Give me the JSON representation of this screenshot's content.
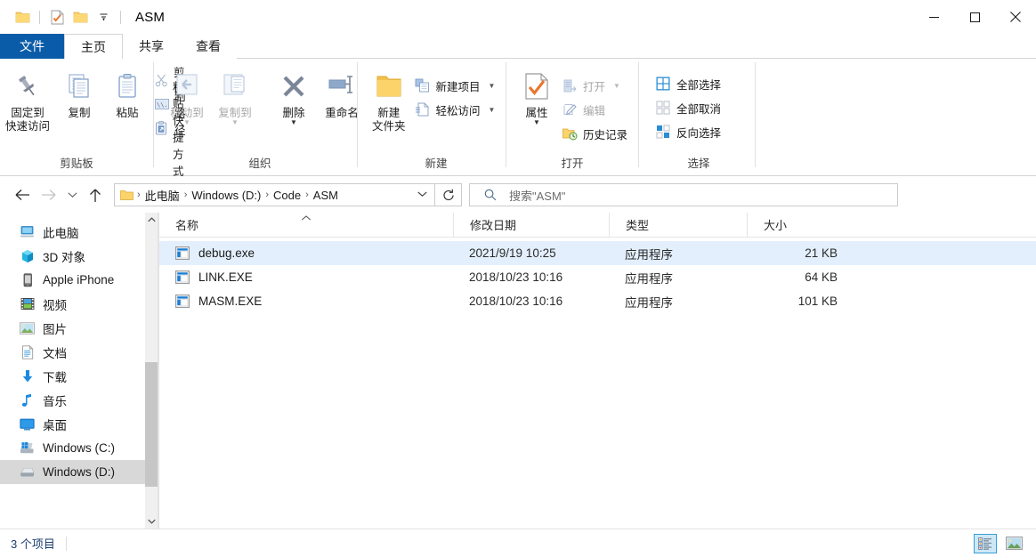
{
  "window": {
    "title": "ASM",
    "quick_access": [
      "folder-icon",
      "properties-icon",
      "new-folder-icon",
      "customize-dropdown"
    ],
    "controls": {
      "minimize": "—",
      "maximize": "□",
      "close": "✕"
    }
  },
  "tabs": [
    {
      "label": "文件",
      "key": "file"
    },
    {
      "label": "主页",
      "key": "home",
      "active": true
    },
    {
      "label": "共享",
      "key": "share"
    },
    {
      "label": "查看",
      "key": "view"
    }
  ],
  "ribbon": {
    "collapse_icon": "chevron-up-icon",
    "help_label": "?",
    "groups": [
      {
        "label": "剪贴板",
        "big": [
          {
            "label": "固定到\n快速访问",
            "line1": "固定到",
            "line2": "快速访问",
            "icon": "pin-icon"
          },
          {
            "label": "复制",
            "line1": "复制",
            "line2": "",
            "icon": "copy-icon"
          },
          {
            "label": "粘贴",
            "line1": "粘贴",
            "line2": "",
            "icon": "paste-icon"
          }
        ],
        "small": [
          {
            "label": "剪切",
            "icon": "scissors-icon",
            "dim": true
          },
          {
            "label": "复制路径",
            "icon": "copy-path-icon",
            "dim": false
          },
          {
            "label": "粘贴快捷方式",
            "icon": "paste-shortcut-icon",
            "dim": false
          }
        ]
      },
      {
        "label": "组织",
        "big": [
          {
            "line1": "移动到",
            "line2": "",
            "icon": "move-to-icon",
            "dim": true,
            "caret": true
          },
          {
            "line1": "复制到",
            "line2": "",
            "icon": "copy-to-icon",
            "dim": true,
            "caret": true
          },
          {
            "line1": "删除",
            "line2": "",
            "icon": "delete-x-icon",
            "caret": true
          },
          {
            "line1": "重命名",
            "line2": "",
            "icon": "rename-icon"
          }
        ],
        "small": []
      },
      {
        "label": "新建",
        "big": [
          {
            "line1": "新建",
            "line2": "文件夹",
            "icon": "new-folder-icon"
          }
        ],
        "small": [
          {
            "label": "新建项目",
            "icon": "new-item-icon",
            "caret": true
          },
          {
            "label": "轻松访问",
            "icon": "easy-access-icon",
            "caret": true
          }
        ]
      },
      {
        "label": "打开",
        "big": [
          {
            "line1": "属性",
            "line2": "",
            "icon": "properties-icon",
            "caret": true
          }
        ],
        "small": [
          {
            "label": "打开",
            "icon": "open-icon",
            "dim": true,
            "caret": true
          },
          {
            "label": "编辑",
            "icon": "edit-icon",
            "dim": true
          },
          {
            "label": "历史记录",
            "icon": "history-icon",
            "dim": false
          }
        ]
      },
      {
        "label": "选择",
        "big": [],
        "small": [
          {
            "label": "全部选择",
            "icon": "select-all-icon"
          },
          {
            "label": "全部取消",
            "icon": "select-none-icon",
            "dim": true
          },
          {
            "label": "反向选择",
            "icon": "invert-selection-icon"
          }
        ]
      }
    ]
  },
  "address": {
    "back_icon": "arrow-left-icon",
    "forward_icon": "arrow-right-icon",
    "recent_icon": "chevron-down-icon",
    "up_icon": "arrow-up-icon",
    "refresh_icon": "refresh-icon",
    "breadcrumb": [
      "此电脑",
      "Windows (D:)",
      "Code",
      "ASM"
    ],
    "dropdown_icon": "chevron-down-icon"
  },
  "search": {
    "icon": "search-icon",
    "placeholder": "搜索\"ASM\""
  },
  "sidebar": {
    "items": [
      {
        "label": "此电脑",
        "icon": "this-pc-icon",
        "selected": false
      },
      {
        "label": "3D 对象",
        "icon": "3d-objects-icon",
        "selected": false
      },
      {
        "label": "Apple iPhone",
        "icon": "iphone-icon",
        "selected": false
      },
      {
        "label": "视频",
        "icon": "videos-icon",
        "selected": false
      },
      {
        "label": "图片",
        "icon": "pictures-icon",
        "selected": false
      },
      {
        "label": "文档",
        "icon": "documents-icon",
        "selected": false
      },
      {
        "label": "下载",
        "icon": "downloads-icon",
        "selected": false
      },
      {
        "label": "音乐",
        "icon": "music-icon",
        "selected": false
      },
      {
        "label": "桌面",
        "icon": "desktop-icon",
        "selected": false
      },
      {
        "label": "Windows (C:)",
        "icon": "drive-c-icon",
        "selected": false
      },
      {
        "label": "Windows (D:)",
        "icon": "drive-d-icon",
        "selected": true
      }
    ]
  },
  "filelist": {
    "columns": [
      {
        "label": "名称",
        "sorted": true
      },
      {
        "label": "修改日期",
        "sorted": false
      },
      {
        "label": "类型",
        "sorted": false
      },
      {
        "label": "大小",
        "sorted": false
      }
    ],
    "rows": [
      {
        "name": "debug.exe",
        "date": "2021/9/19 10:25",
        "type": "应用程序",
        "size": "21 KB",
        "icon": "exe-icon",
        "selected": true
      },
      {
        "name": "LINK.EXE",
        "date": "2018/10/23 10:16",
        "type": "应用程序",
        "size": "64 KB",
        "icon": "exe-icon",
        "selected": false
      },
      {
        "name": "MASM.EXE",
        "date": "2018/10/23 10:16",
        "type": "应用程序",
        "size": "101 KB",
        "icon": "exe-icon",
        "selected": false
      }
    ]
  },
  "statusbar": {
    "count_text": "3 个项目",
    "views": [
      {
        "name": "details-view",
        "active": true
      },
      {
        "name": "large-icons-view",
        "active": false
      }
    ]
  },
  "colors": {
    "accent": "#0a5ca8",
    "selection": "#e3effc",
    "help_blue": "#1477d3",
    "status_text": "#1a3d6e"
  }
}
